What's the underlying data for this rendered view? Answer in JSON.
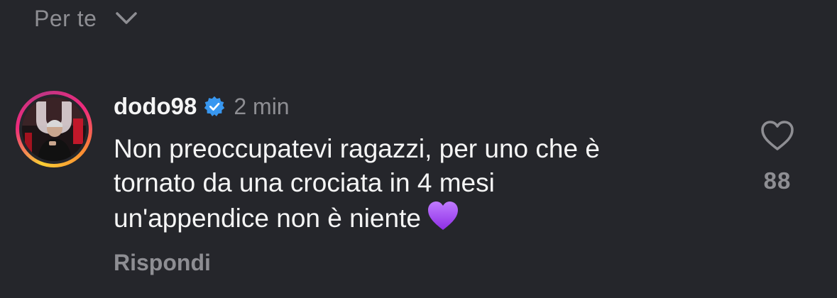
{
  "sort": {
    "label": "Per te",
    "icon": "chevron-down-icon"
  },
  "comment": {
    "username": "dodo98",
    "verified": true,
    "verified_color": "#3897f0",
    "timestamp": "2 min",
    "lines": [
      "Non preoccupatevi ragazzi, per uno che è",
      "tornato da una crociata in 4 mesi",
      "un'appendice non è niente"
    ],
    "emoji": "purple-heart",
    "reply_label": "Rispondi",
    "likes": "88",
    "like_icon": "heart-outline-icon"
  },
  "colors": {
    "background": "#25262b",
    "primary_text": "#f5f5f5",
    "secondary_text": "#8e8e93",
    "story_ring_start": "#f9ce34",
    "story_ring_end": "#ee2a7b",
    "emoji_purple": "#a855f7"
  }
}
